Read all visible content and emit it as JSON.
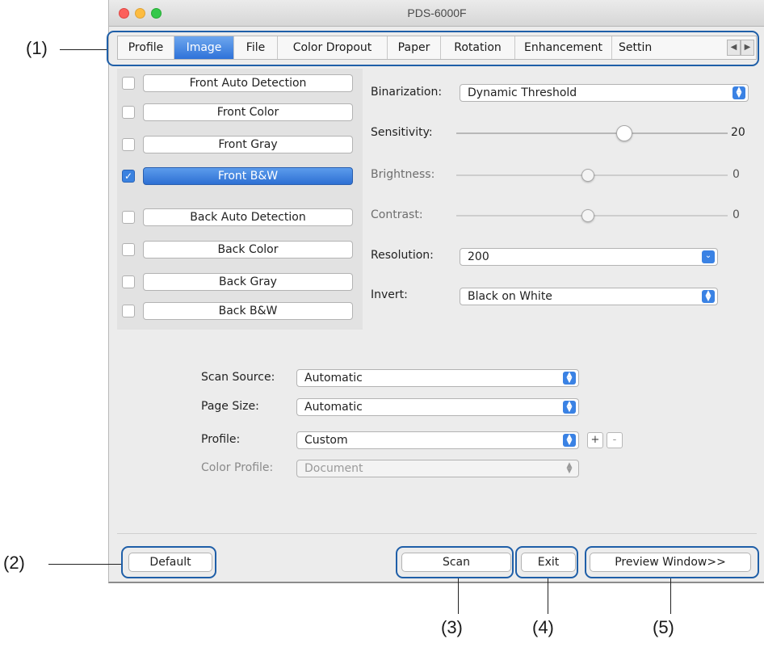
{
  "window": {
    "title": "PDS-6000F"
  },
  "tabs": [
    {
      "label": "Profile"
    },
    {
      "label": "Image"
    },
    {
      "label": "File"
    },
    {
      "label": "Color Dropout"
    },
    {
      "label": "Paper"
    },
    {
      "label": "Rotation"
    },
    {
      "label": "Enhancement"
    },
    {
      "label": "Settin"
    }
  ],
  "image_options": [
    {
      "label": "Front Auto Detection",
      "checked": false
    },
    {
      "label": "Front Color",
      "checked": false
    },
    {
      "label": "Front Gray",
      "checked": false
    },
    {
      "label": "Front B&W",
      "checked": true
    },
    {
      "label": "Back Auto Detection",
      "checked": false
    },
    {
      "label": "Back Color",
      "checked": false
    },
    {
      "label": "Back Gray",
      "checked": false
    },
    {
      "label": "Back B&W",
      "checked": false
    }
  ],
  "settings": {
    "binarization": {
      "label": "Binarization:",
      "value": "Dynamic Threshold"
    },
    "sensitivity": {
      "label": "Sensitivity:",
      "value": "20"
    },
    "brightness": {
      "label": "Brightness:",
      "value": "0"
    },
    "contrast": {
      "label": "Contrast:",
      "value": "0"
    },
    "resolution": {
      "label": "Resolution:",
      "value": "200"
    },
    "invert": {
      "label": "Invert:",
      "value": "Black on White"
    }
  },
  "scan": {
    "scan_source": {
      "label": "Scan Source:",
      "value": "Automatic"
    },
    "page_size": {
      "label": "Page Size:",
      "value": "Automatic"
    },
    "profile": {
      "label": "Profile:",
      "value": "Custom"
    },
    "color_profile": {
      "label": "Color Profile:",
      "value": "Document"
    },
    "add_symbol": "+",
    "remove_symbol": "-"
  },
  "buttons": {
    "default": "Default",
    "scan": "Scan",
    "exit": "Exit",
    "preview": "Preview Window>>"
  },
  "callouts": [
    "(1)",
    "(2)",
    "(3)",
    "(4)",
    "(5)"
  ],
  "colors": {
    "accent": "#2e72d9",
    "callout_ring": "#1f5fa8"
  }
}
